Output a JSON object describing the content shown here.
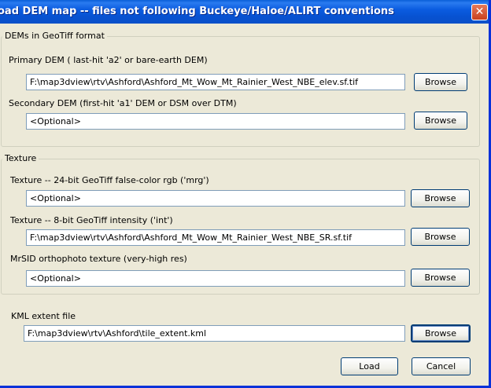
{
  "window": {
    "title": "oad DEM map -- files not following Buckeye/Haloe/ALIRT conventions",
    "close_glyph": "✕"
  },
  "dem_group": {
    "legend": "DEMs in GeoTiff format",
    "primary_label": "Primary DEM ( last-hit 'a2' or bare-earth DEM)",
    "primary_value": "F:\\map3dview\\rtv\\Ashford\\Ashford_Mt_Wow_Mt_Rainier_West_NBE_elev.sf.tif",
    "secondary_label": "Secondary DEM (first-hit 'a1' DEM or DSM over DTM)",
    "secondary_value": "<Optional>"
  },
  "texture_group": {
    "legend": "Texture",
    "rgb_label": "Texture -- 24-bit GeoTiff false-color rgb ('mrg')",
    "rgb_value": "<Optional>",
    "intensity_label": "Texture -- 8-bit GeoTiff intensity ('int')",
    "intensity_value": "F:\\map3dview\\rtv\\Ashford\\Ashford_Mt_Wow_Mt_Rainier_West_NBE_SR.sf.tif",
    "mrsid_label": "MrSID orthophoto texture (very-high res)",
    "mrsid_value": "<Optional>"
  },
  "kml": {
    "label": "KML extent file",
    "value": "F:\\map3dview\\rtv\\Ashford\\tile_extent.kml"
  },
  "buttons": {
    "browse": "Browse",
    "load": "Load",
    "cancel": "Cancel"
  }
}
